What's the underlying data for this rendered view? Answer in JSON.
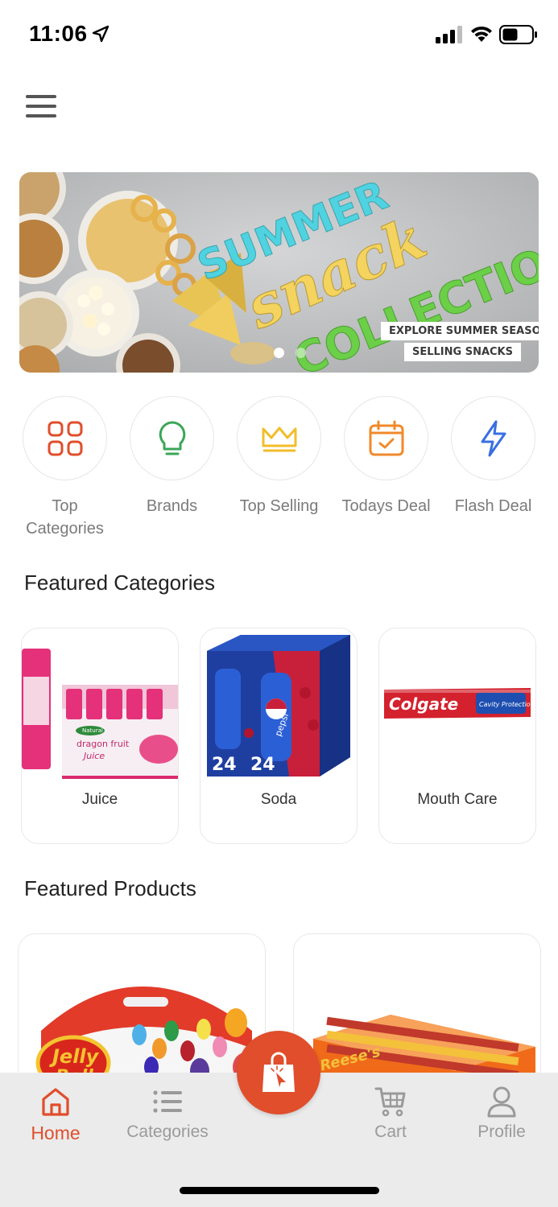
{
  "status": {
    "time": "11:06",
    "icons": [
      "location-arrow-icon",
      "signal-icon",
      "wifi-icon",
      "battery-icon"
    ]
  },
  "header": {
    "menu_icon": "hamburger-menu-icon"
  },
  "banner": {
    "title_line1": "SUMMER",
    "title_line2": "snack",
    "title_line3": "COLLECTION",
    "cta_line1": "EXPLORE SUMMER SEASON '",
    "cta_line2": "SELLING SNACKS",
    "slides_total": 2,
    "active_slide": 1
  },
  "quick_links": [
    {
      "label": "Top Categories",
      "icon": "grid-icon"
    },
    {
      "label": "Brands",
      "icon": "lightbulb-icon"
    },
    {
      "label": "Top Selling",
      "icon": "crown-icon"
    },
    {
      "label": "Todays Deal",
      "icon": "calendar-check-icon"
    },
    {
      "label": "Flash Deal",
      "icon": "lightning-icon"
    }
  ],
  "featured_categories": {
    "title": "Featured Categories",
    "items": [
      {
        "label": "Juice"
      },
      {
        "label": "Soda"
      },
      {
        "label": "Mouth Care"
      }
    ]
  },
  "featured_products": {
    "title": "Featured Products"
  },
  "product_text": {
    "jelly": "Jelly",
    "belly": "Belly",
    "reeses": "Reese's"
  },
  "category_text": {
    "juice_brand": "Natural",
    "juice_line1": "dragon fruit",
    "juice_line2": "Juice",
    "soda_brand": "pepsi",
    "soda_count": "24",
    "colgate_brand": "Colgate",
    "colgate_sub": "Cavity Protection"
  },
  "bottom_nav": {
    "items": [
      {
        "label": "Home",
        "icon": "home-icon",
        "active": true
      },
      {
        "label": "Categories",
        "icon": "list-icon",
        "active": false
      },
      {
        "label": "Cart",
        "icon": "cart-icon",
        "active": false
      },
      {
        "label": "Profile",
        "icon": "user-icon",
        "active": false
      }
    ],
    "fab_icon": "shopping-bag-icon"
  },
  "colors": {
    "accent": "#e04e2c",
    "quick_grid": "#e04e2c",
    "quick_bulb": "#3aa657",
    "quick_crown": "#f2bd2a",
    "quick_calendar": "#f08a2a",
    "quick_flash": "#3a6fe0"
  }
}
